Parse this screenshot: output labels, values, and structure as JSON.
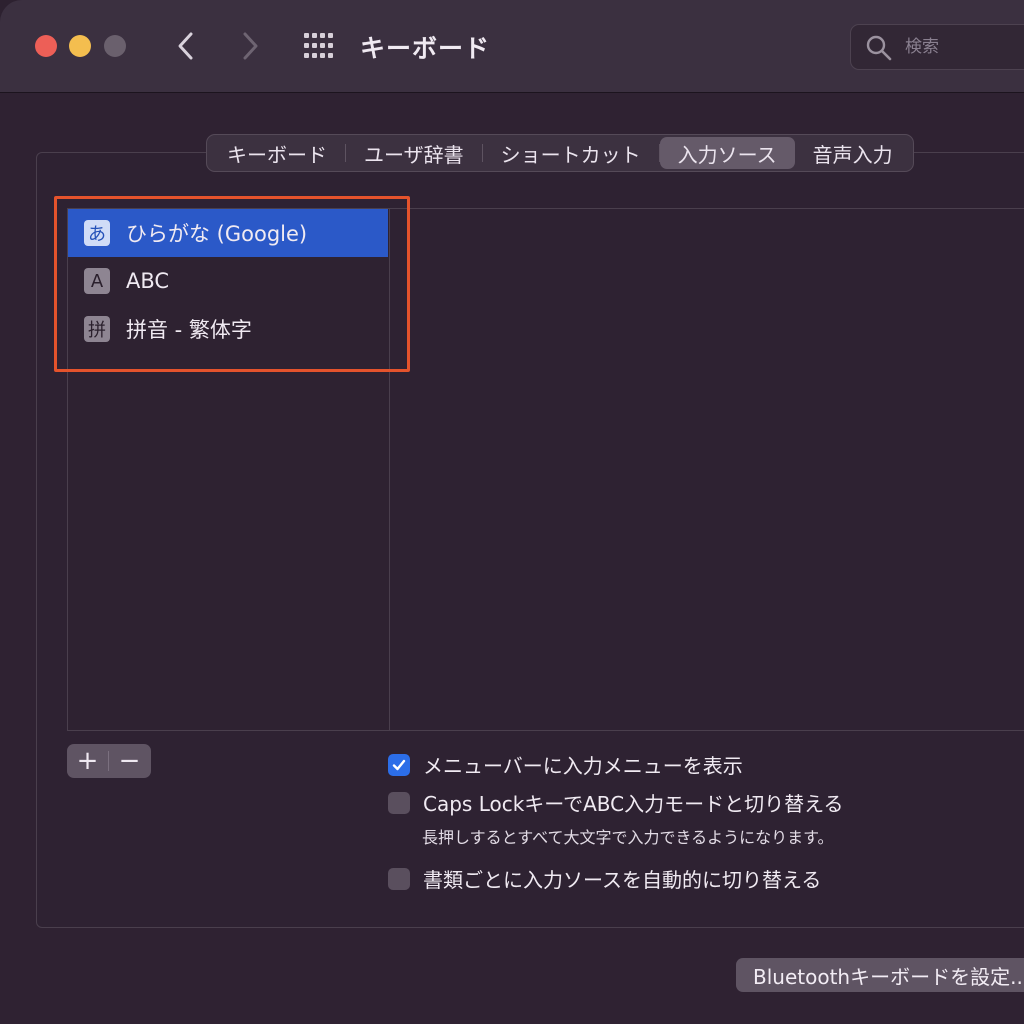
{
  "window": {
    "title": "キーボード"
  },
  "search": {
    "placeholder": "検索"
  },
  "tabs": [
    {
      "label": "キーボード",
      "active": false
    },
    {
      "label": "ユーザ辞書",
      "active": false
    },
    {
      "label": "ショートカット",
      "active": false
    },
    {
      "label": "入力ソース",
      "active": true
    },
    {
      "label": "音声入力",
      "active": false
    }
  ],
  "input_sources": [
    {
      "badge": "あ",
      "label": "ひらがな (Google)",
      "selected": true
    },
    {
      "badge": "A",
      "label": "ABC",
      "selected": false
    },
    {
      "badge": "拼",
      "label": "拼音 - 繁体字",
      "selected": false
    }
  ],
  "list_controls": {
    "add": "+",
    "remove": "−"
  },
  "options": [
    {
      "label": "メニューバーに入力メニューを表示",
      "checked": true
    },
    {
      "label": "Caps LockキーでABC入力モードと切り替える",
      "checked": false,
      "note": "長押しするとすべて大文字で入力できるようになります。"
    },
    {
      "label": "書類ごとに入力ソースを自動的に切り替える",
      "checked": false
    }
  ],
  "bluetooth_button": "Bluetoothキーボードを設定...",
  "colors": {
    "selection": "#2b59c8",
    "checkbox_on": "#2c6ee8",
    "highlight_box": "#e4532c"
  },
  "icons": [
    "back-chevron-icon",
    "forward-chevron-icon",
    "grid-icon",
    "search-icon",
    "checkmark-icon"
  ]
}
